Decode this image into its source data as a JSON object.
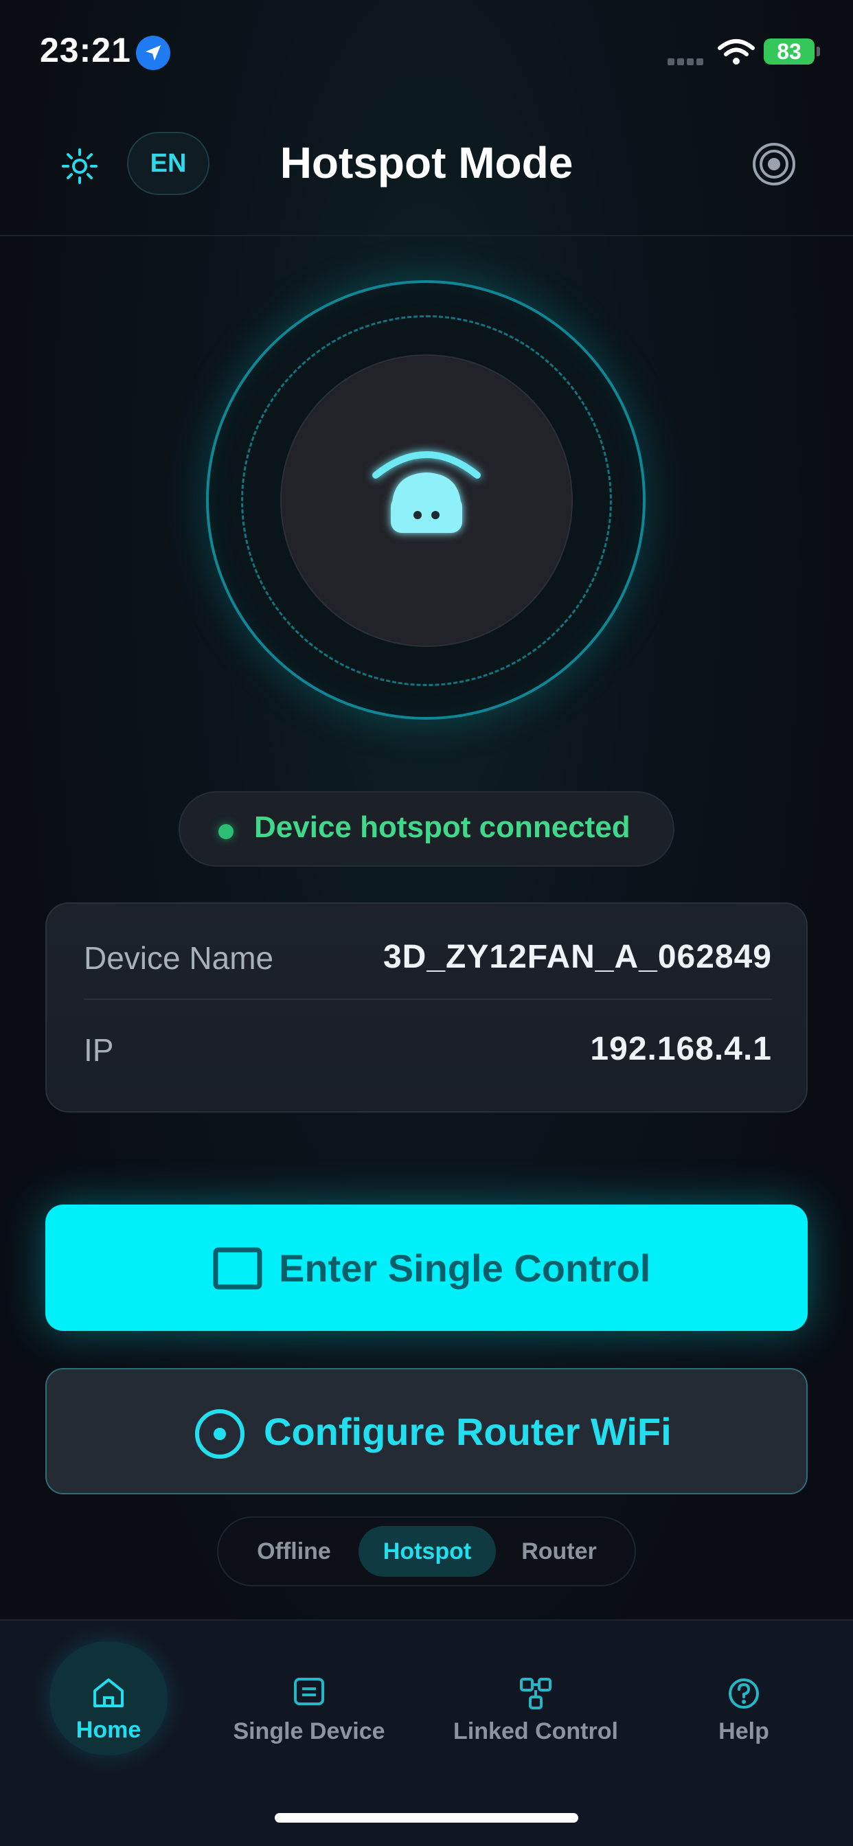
{
  "status_bar": {
    "time": "23:21",
    "battery": "83"
  },
  "header": {
    "language": "EN",
    "title": "Hotspot Mode"
  },
  "status": {
    "text": "Device hotspot connected",
    "color": "#40d88a"
  },
  "device_info": [
    {
      "label": "Device Name",
      "value": "3D_ZY12FAN_A_062849"
    },
    {
      "label": "IP",
      "value": "192.168.4.1"
    }
  ],
  "actions": {
    "primary_label": "Enter Single Control",
    "secondary_label": "Configure Router WiFi"
  },
  "mode_selector": {
    "options": [
      "Offline",
      "Hotspot",
      "Router"
    ],
    "selected": "Hotspot"
  },
  "tab_bar": {
    "tabs": [
      {
        "label": "Home",
        "icon": "home-icon",
        "active": true
      },
      {
        "label": "Single Device",
        "icon": "single-device-icon",
        "active": false
      },
      {
        "label": "Linked Control",
        "icon": "linked-control-icon",
        "active": false
      },
      {
        "label": "Help",
        "icon": "help-icon",
        "active": false
      }
    ]
  },
  "colors": {
    "accent": "#00f0fb",
    "accent_text": "#22dff0",
    "background": "#0b0f15",
    "success": "#2bbf73"
  }
}
